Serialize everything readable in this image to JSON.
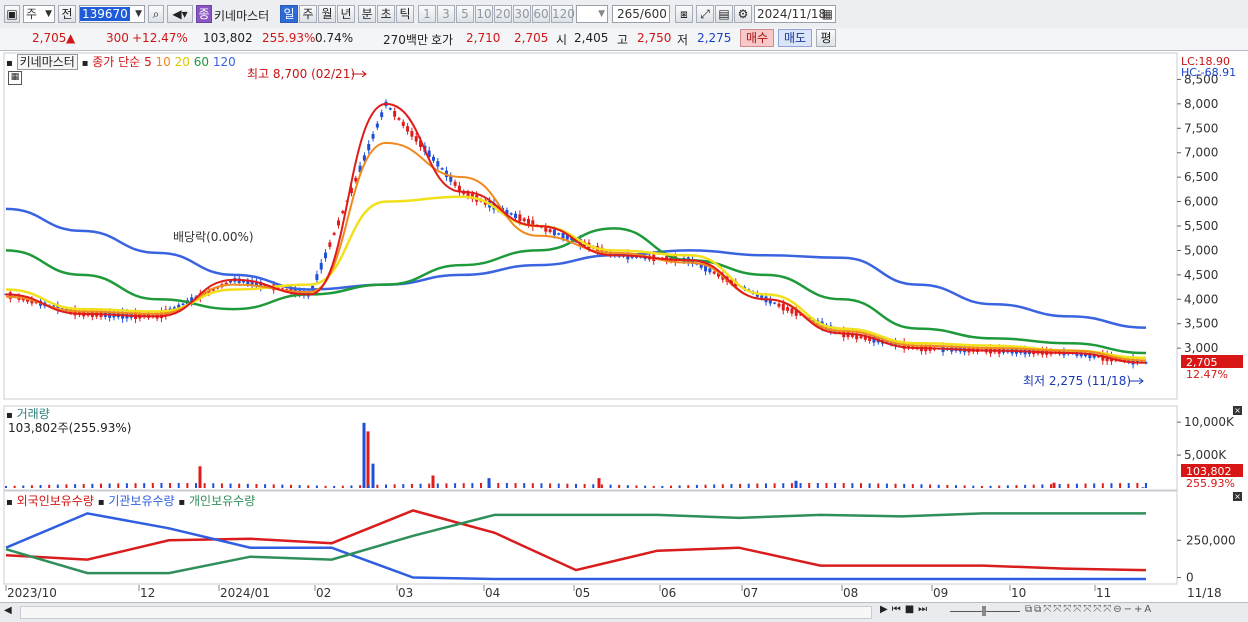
{
  "toolbar": {
    "market_select": "주",
    "prev_label": "전",
    "code": "139670",
    "stock_name": "키네마스터",
    "type_badge": "종",
    "period_buttons": [
      "일",
      "주",
      "월",
      "년",
      "분",
      "초",
      "틱"
    ],
    "active_period": "일",
    "interval_buttons": [
      "1",
      "3",
      "5",
      "10",
      "20",
      "30",
      "60",
      "120"
    ],
    "count": "265",
    "count_max": "/600",
    "date": "2024/11/18"
  },
  "quote": {
    "price": "2,705",
    "change": "300",
    "change_pct": "+12.47%",
    "volume": "103,802",
    "volume_ratio": "255.93%",
    "turnover_rate": "0.74%",
    "amount": "270백만",
    "hoga_label": "호가",
    "ask": "2,710",
    "bid": "2,705",
    "open_label": "시",
    "open": "2,405",
    "high_label": "고",
    "high": "2,750",
    "low_label": "저",
    "low": "2,275",
    "buy_label": "매수",
    "sell_label": "매도",
    "eval_label": "평"
  },
  "price_panel": {
    "stock_tag": "키네마스터",
    "ma_legend": {
      "prefix": "종가 단순",
      "periods": [
        "5",
        "10",
        "20",
        "60",
        "120"
      ]
    },
    "lc": "LC:18.90",
    "hc": "HC:-68.91",
    "high_annotation": "최고 8,700 (02/21)",
    "low_annotation": "최저 2,275 (11/18)",
    "dividend_annotation": "배당락(0.00%)",
    "current_price_tag": "2,705",
    "current_pct_tag": "12.47%"
  },
  "volume_panel": {
    "title": "거래량",
    "value": "103,802주(255.93%)",
    "current_tag": "103,802",
    "current_pct_tag": "255.93%"
  },
  "holdings_panel": {
    "legend": [
      "외국인보유수량",
      "기관보유수량",
      "개인보유수량"
    ]
  },
  "x_axis": {
    "labels": [
      "2023/10",
      "12",
      "2024/01",
      "02",
      "03",
      "04",
      "05",
      "06",
      "07",
      "08",
      "09",
      "10",
      "11",
      "11/18"
    ]
  },
  "colors": {
    "up": "#e01b1b",
    "down": "#1f4fd8",
    "ma5": "#e01b1b",
    "ma10": "#f08a1c",
    "ma20": "#f2e01a",
    "ma60": "#1e9a3a",
    "ma120": "#3a63e0",
    "foreign": "#d91c1c",
    "institution": "#2f5fe0",
    "individual": "#2f8f5a"
  },
  "chart_data": [
    {
      "type": "line",
      "title": "키네마스터",
      "xlabel": "",
      "ylabel": "",
      "ylim": [
        2000,
        9000
      ],
      "y_ticks": [
        "3,000",
        "3,500",
        "4,000",
        "4,500",
        "5,000",
        "5,500",
        "6,000",
        "6,500",
        "7,000",
        "7,500",
        "8,000",
        "8,500"
      ],
      "x": [
        "2023/10",
        "11",
        "12",
        "2024/01",
        "02",
        "02/21",
        "03",
        "04",
        "05",
        "06",
        "07",
        "08",
        "09",
        "10",
        "11",
        "11/18"
      ],
      "series": [
        {
          "name": "5",
          "values": [
            4100,
            3700,
            3650,
            4400,
            4100,
            8000,
            6200,
            5500,
            4900,
            4800,
            4000,
            3300,
            3000,
            2950,
            2900,
            2700
          ]
        },
        {
          "name": "10",
          "values": [
            4050,
            3750,
            3700,
            4300,
            4150,
            7200,
            6500,
            5300,
            4950,
            4750,
            4000,
            3350,
            3050,
            3000,
            2950,
            2750
          ]
        },
        {
          "name": "20",
          "values": [
            4200,
            3800,
            3750,
            4200,
            4300,
            6000,
            6100,
            5500,
            5000,
            4900,
            4100,
            3400,
            3100,
            3050,
            2950,
            2800
          ]
        },
        {
          "name": "60",
          "values": [
            5000,
            4500,
            4000,
            3800,
            4100,
            4300,
            4700,
            5000,
            5450,
            4800,
            4500,
            4000,
            3400,
            3200,
            3100,
            2900
          ]
        },
        {
          "name": "120",
          "values": [
            5850,
            5400,
            4950,
            4500,
            4200,
            4300,
            4500,
            4700,
            4900,
            5000,
            4900,
            4850,
            4300,
            3900,
            3650,
            3420
          ]
        }
      ]
    },
    {
      "type": "bar",
      "title": "거래량",
      "ylim": [
        0,
        12000
      ],
      "y_ticks": [
        "5,000K",
        "10,000K"
      ],
      "x": [
        "12/26",
        "02/21",
        "02/22",
        "02/23",
        "03/29",
        "04/24",
        "05/03",
        "07/17",
        "10/15",
        "11/18"
      ],
      "values": [
        3300,
        9900,
        8600,
        3700,
        1900,
        1500,
        1500,
        1100,
        800,
        104
      ]
    },
    {
      "type": "line",
      "title": "",
      "ylim": [
        -30000,
        500000
      ],
      "y_ticks": [
        "0",
        "250,000"
      ],
      "x": [
        "2023/10",
        "11",
        "12",
        "2024/01",
        "02",
        "03",
        "04",
        "05",
        "06",
        "07",
        "08",
        "09",
        "10",
        "11",
        "11/18"
      ],
      "series": [
        {
          "name": "외국인보유수량",
          "values": [
            150000,
            120000,
            250000,
            260000,
            230000,
            450000,
            300000,
            50000,
            180000,
            200000,
            80000,
            80000,
            80000,
            60000,
            50000
          ]
        },
        {
          "name": "기관보유수량",
          "values": [
            200000,
            430000,
            330000,
            200000,
            200000,
            0,
            -10000,
            -10000,
            -10000,
            -10000,
            -10000,
            -10000,
            -10000,
            -10000,
            -10000
          ]
        },
        {
          "name": "개인보유수량",
          "values": [
            190000,
            30000,
            30000,
            140000,
            120000,
            280000,
            420000,
            420000,
            420000,
            400000,
            420000,
            410000,
            430000,
            430000,
            430000
          ]
        }
      ]
    }
  ]
}
